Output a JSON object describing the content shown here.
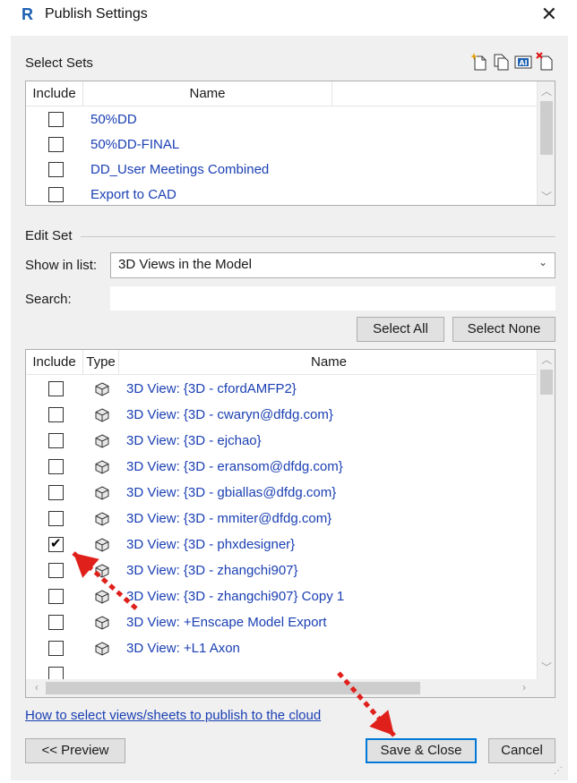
{
  "window": {
    "title": "Publish Settings",
    "app_icon": "revit-r-icon",
    "close_glyph": "✕"
  },
  "select_sets": {
    "label": "Select Sets",
    "columns": [
      "Include",
      "Name"
    ],
    "rows": [
      {
        "name": "50%DD",
        "checked": false
      },
      {
        "name": "50%DD-FINAL",
        "checked": false
      },
      {
        "name": "DD_User Meetings Combined",
        "checked": false
      },
      {
        "name": "Export to CAD",
        "checked": false
      }
    ],
    "toolbar": [
      "new-set-icon",
      "duplicate-set-icon",
      "rename-set-icon",
      "delete-set-icon"
    ]
  },
  "edit_set": {
    "label": "Edit Set",
    "show_in_list_label": "Show in list:",
    "show_in_list_value": "3D Views in the Model",
    "search_label": "Search:",
    "search_value": "",
    "select_all": "Select All",
    "select_none": "Select None",
    "columns": [
      "Include",
      "Type",
      "Name"
    ],
    "rows": [
      {
        "name": "3D View: {3D - cfordAMFP2}",
        "checked": false
      },
      {
        "name": "3D View: {3D - cwaryn@dfdg.com}",
        "checked": false
      },
      {
        "name": "3D View: {3D - ejchao}",
        "checked": false
      },
      {
        "name": "3D View: {3D - eransom@dfdg.com}",
        "checked": false
      },
      {
        "name": "3D View: {3D - gbiallas@dfdg.com}",
        "checked": false
      },
      {
        "name": "3D View: {3D - mmiter@dfdg.com}",
        "checked": false
      },
      {
        "name": "3D View: {3D - phxdesigner}",
        "checked": true
      },
      {
        "name": "3D View: {3D - zhangchi907}",
        "checked": false
      },
      {
        "name": "3D View: {3D - zhangchi907} Copy 1",
        "checked": false
      },
      {
        "name": "3D View: +Enscape Model Export",
        "checked": false
      },
      {
        "name": "3D View: +L1 Axon",
        "checked": false
      }
    ]
  },
  "footer": {
    "help_link": "How to select views/sheets to publish to the cloud",
    "preview": "<< Preview",
    "save_close": "Save & Close",
    "cancel": "Cancel"
  },
  "annotations": {
    "arrow_color": "#e0201b"
  }
}
